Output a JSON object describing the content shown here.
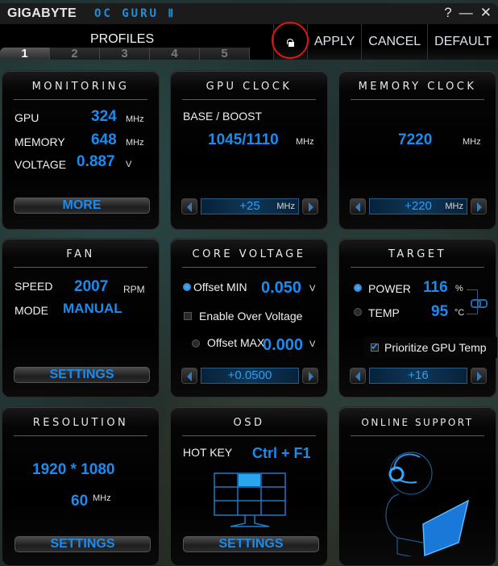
{
  "titlebar": {
    "brand": "GIGABYTE",
    "app_name": "OC GURU Ⅱ",
    "help_icon": "?",
    "minimize_icon": "—",
    "close_icon": "✕"
  },
  "toolbar": {
    "profiles_label": "PROFILES",
    "profile_tabs": [
      "1",
      "2",
      "3",
      "4",
      "5"
    ],
    "active_profile": "1",
    "lock_icon": "unlock-icon",
    "apply_label": "APPLY",
    "cancel_label": "CANCEL",
    "default_label": "DEFAULT"
  },
  "monitoring": {
    "title": "MONITORING",
    "rows": [
      {
        "label": "GPU",
        "value": "324",
        "unit": "MHz"
      },
      {
        "label": "MEMORY",
        "value": "648",
        "unit": "MHz"
      },
      {
        "label": "VOLTAGE",
        "value": "0.887",
        "unit": "V"
      }
    ],
    "button_label": "MORE"
  },
  "gpu_clock": {
    "title": "GPU CLOCK",
    "label": "BASE / BOOST",
    "value": "1045/1110",
    "unit": "MHz",
    "offset_value": "+25",
    "offset_unit": "MHz"
  },
  "memory_clock": {
    "title": "MEMORY CLOCK",
    "value": "7220",
    "unit": "MHz",
    "offset_value": "+220",
    "offset_unit": "MHz"
  },
  "fan": {
    "title": "FAN",
    "speed_label": "SPEED",
    "speed_value": "2007",
    "speed_unit": "RPM",
    "mode_label": "MODE",
    "mode_value": "MANUAL",
    "button_label": "SETTINGS"
  },
  "core_voltage": {
    "title": "CORE VOLTAGE",
    "offset_min_label": "Offset MIN",
    "offset_min_value": "0.050",
    "offset_min_unit": "V",
    "offset_min_selected": true,
    "over_voltage_label": "Enable Over Voltage",
    "over_voltage_checked": false,
    "offset_max_label": "Offset MAX",
    "offset_max_value": "0.000",
    "offset_max_unit": "V",
    "offset_max_selected": false,
    "stepper_value": "+0.0500"
  },
  "target": {
    "title": "TARGET",
    "power_label": "POWER",
    "power_value": "116",
    "power_unit": "%",
    "power_selected": true,
    "temp_label": "TEMP",
    "temp_value": "95",
    "temp_unit": "°C",
    "temp_selected": false,
    "prioritize_label": "Prioritize GPU Temp",
    "prioritize_checked": true,
    "stepper_value": "+16"
  },
  "resolution": {
    "title": "RESOLUTION",
    "value": "1920 * 1080",
    "refresh_value": "60",
    "refresh_unit": "MHz",
    "button_label": "SETTINGS"
  },
  "osd": {
    "title": "OSD",
    "hotkey_label": "HOT KEY",
    "hotkey_value": "Ctrl + F1",
    "selected_position": "top-center",
    "button_label": "SETTINGS"
  },
  "online_support": {
    "title": "ONLINE SUPPORT"
  },
  "colors": {
    "accent": "#1a8cf0",
    "annotation": "#e01414"
  }
}
